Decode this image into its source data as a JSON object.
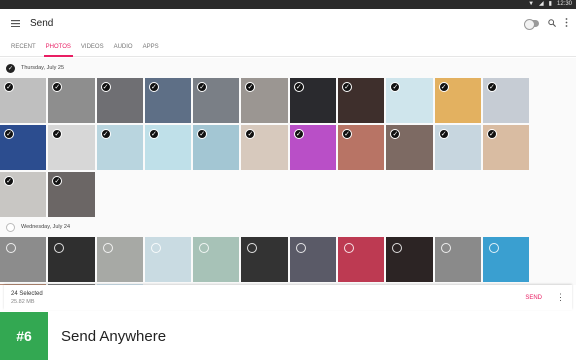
{
  "statusbar": {
    "clock": "12:30"
  },
  "appbar": {
    "title": "Send"
  },
  "tabs": [
    {
      "label": "RECENT"
    },
    {
      "label": "PHOTOS"
    },
    {
      "label": "VIDEOS"
    },
    {
      "label": "AUDIO"
    },
    {
      "label": "APPS"
    }
  ],
  "groups": [
    {
      "date": "Thursday, July 25",
      "selected": true,
      "tiles": [
        {
          "color": "#bfbfbf",
          "sel": true
        },
        {
          "color": "#8e8e8e",
          "sel": true
        },
        {
          "color": "#6f6f73",
          "sel": true
        },
        {
          "color": "#5e6f86",
          "sel": true
        },
        {
          "color": "#7a7f86",
          "sel": true
        },
        {
          "color": "#9b9692",
          "sel": true
        },
        {
          "color": "#2a2a2e",
          "sel": true
        },
        {
          "color": "#3e2f2c",
          "sel": true
        },
        {
          "color": "#cfe5ec",
          "sel": true
        },
        {
          "color": "#e3b160",
          "sel": true
        },
        {
          "color": "#c6ccd4",
          "sel": true
        },
        {
          "color": "#2c4d8f",
          "sel": true
        },
        {
          "color": "#d7d7d7",
          "sel": true
        },
        {
          "color": "#b9d5df",
          "sel": true
        },
        {
          "color": "#bfe0e9",
          "sel": true
        },
        {
          "color": "#a3c6d3",
          "sel": true
        },
        {
          "color": "#d7c9bd",
          "sel": true
        },
        {
          "color": "#b94fc7",
          "sel": true
        },
        {
          "color": "#b87465",
          "sel": true
        },
        {
          "color": "#7d6a63",
          "sel": true
        },
        {
          "color": "#c7d6df",
          "sel": true
        },
        {
          "color": "#d9bca2",
          "sel": true
        },
        {
          "color": "#c8c6c3",
          "sel": true
        },
        {
          "color": "#6b6665",
          "sel": true
        }
      ]
    },
    {
      "date": "Wednesday, July 24",
      "selected": false,
      "tiles": [
        {
          "color": "#8c8c8c",
          "sel": false
        },
        {
          "color": "#2f2f2f",
          "sel": false
        },
        {
          "color": "#a7a9a5",
          "sel": false
        },
        {
          "color": "#c9dbe2",
          "sel": false
        },
        {
          "color": "#a7c2b7",
          "sel": false
        },
        {
          "color": "#333333",
          "sel": false
        },
        {
          "color": "#5a5a67",
          "sel": false
        },
        {
          "color": "#bd3a52",
          "sel": false
        },
        {
          "color": "#2c2424",
          "sel": false
        },
        {
          "color": "#8a8a8a",
          "sel": false
        },
        {
          "color": "#3a9fd0",
          "sel": false
        },
        {
          "color": "#b58a74",
          "sel": false
        },
        {
          "color": "#7d7d7d",
          "sel": false
        },
        {
          "color": "#cfe3ee",
          "sel": false
        }
      ]
    }
  ],
  "bottombar": {
    "selected_label": "24 Selected",
    "size_label": "25.82 MB",
    "send_label": "SEND"
  },
  "banner": {
    "rank": "#6",
    "app_name": "Send Anywhere"
  }
}
